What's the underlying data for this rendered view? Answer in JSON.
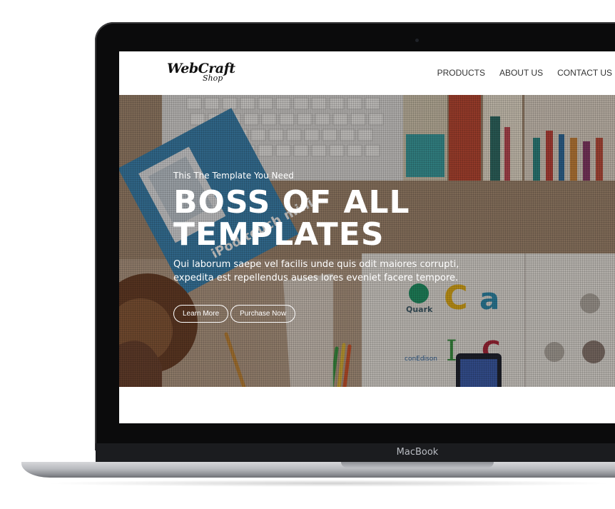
{
  "device": {
    "brand_label": "MacBook"
  },
  "navbar": {
    "logo": {
      "main": "WebCraft",
      "sub": "Shop"
    },
    "items": [
      {
        "label": "PRODUCTS"
      },
      {
        "label": "ABOUT US"
      },
      {
        "label": "CONTACT US"
      }
    ]
  },
  "hero": {
    "eyebrow": "This The Template You Need",
    "title_line1": "BOSS OF ALL",
    "title_line2": "TEMPLATES",
    "description": "Qui laborum saepe vel facilis unde quis odit maiores corrupti, expedita est repellendus auses lores eveniet facere tempore.",
    "buttons": [
      {
        "label": "Learn More"
      },
      {
        "label": "Purchase Now"
      }
    ],
    "photo_text": {
      "tablet": "iPod touch mini",
      "logo_quark": "Quark",
      "logo_conedison": "conEdison"
    }
  }
}
